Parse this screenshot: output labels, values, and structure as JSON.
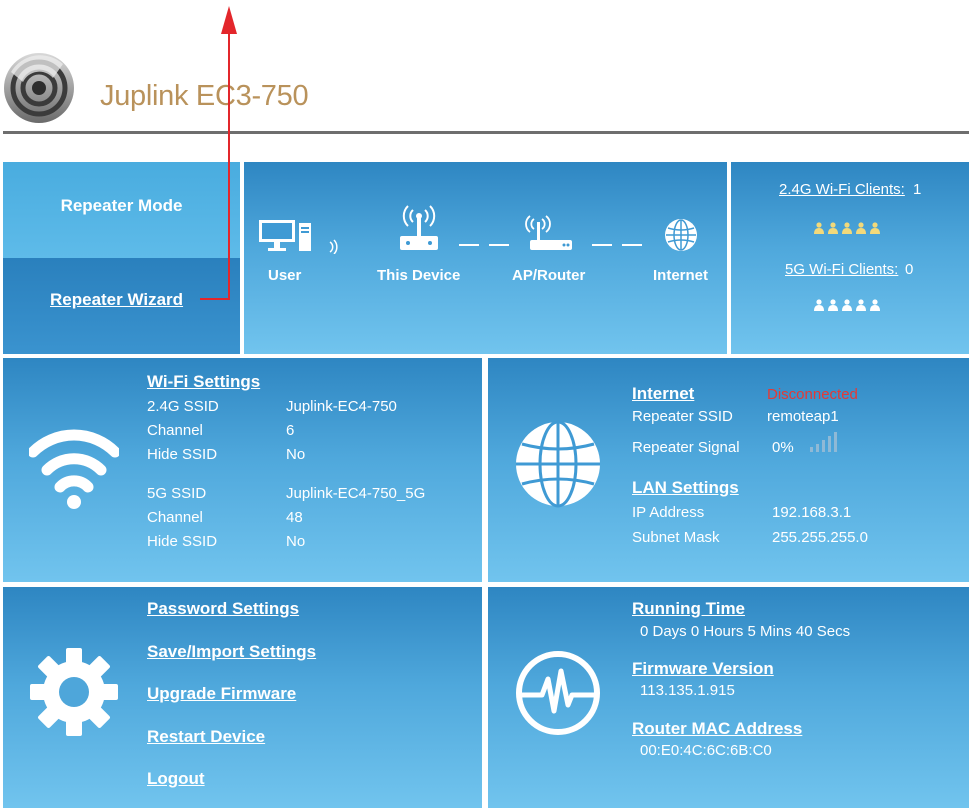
{
  "header": {
    "brand": "Juplink EC3-750"
  },
  "mode": {
    "current": "Repeater Mode",
    "wizard_link": "Repeater Wizard"
  },
  "topology": {
    "user": "User",
    "device": "This Device",
    "router": "AP/Router",
    "internet": "Internet"
  },
  "clients": {
    "g24_label": "2.4G Wi-Fi Clients:",
    "g24_count": "1",
    "g5_label": "5G Wi-Fi Clients:",
    "g5_count": "0",
    "active_color": "#f2d97a",
    "inactive_color": "#ffffff"
  },
  "wifi": {
    "title": "Wi-Fi Settings",
    "rows24": [
      {
        "label": "2.4G SSID",
        "value": "Juplink-EC4-750"
      },
      {
        "label": "Channel",
        "value": "6"
      },
      {
        "label": "Hide SSID",
        "value": "No"
      }
    ],
    "rows5": [
      {
        "label": "5G SSID",
        "value": "Juplink-EC4-750_5G"
      },
      {
        "label": "Channel",
        "value": "48"
      },
      {
        "label": "Hide SSID",
        "value": "No"
      }
    ]
  },
  "internet": {
    "title": "Internet",
    "status": "Disconnected",
    "status_color": "#e53935",
    "ssid_label": "Repeater SSID",
    "ssid_value": "remoteap1",
    "signal_label": "Repeater Signal",
    "signal_value": "0%"
  },
  "lan": {
    "title": "LAN Settings",
    "ip_label": "IP Address",
    "ip_value": "192.168.3.1",
    "mask_label": "Subnet Mask",
    "mask_value": "255.255.255.0"
  },
  "system": {
    "links": [
      "Password Settings",
      "Save/Import Settings",
      "Upgrade Firmware",
      "Restart Device",
      "Logout"
    ]
  },
  "status": {
    "running_title": "Running Time",
    "running_value": "0 Days 0 Hours 5 Mins 40 Secs",
    "firmware_title": "Firmware Version",
    "firmware_value": "113.135.1.915",
    "mac_title": "Router MAC Address",
    "mac_value": "00:E0:4C:6C:6B:C0"
  }
}
